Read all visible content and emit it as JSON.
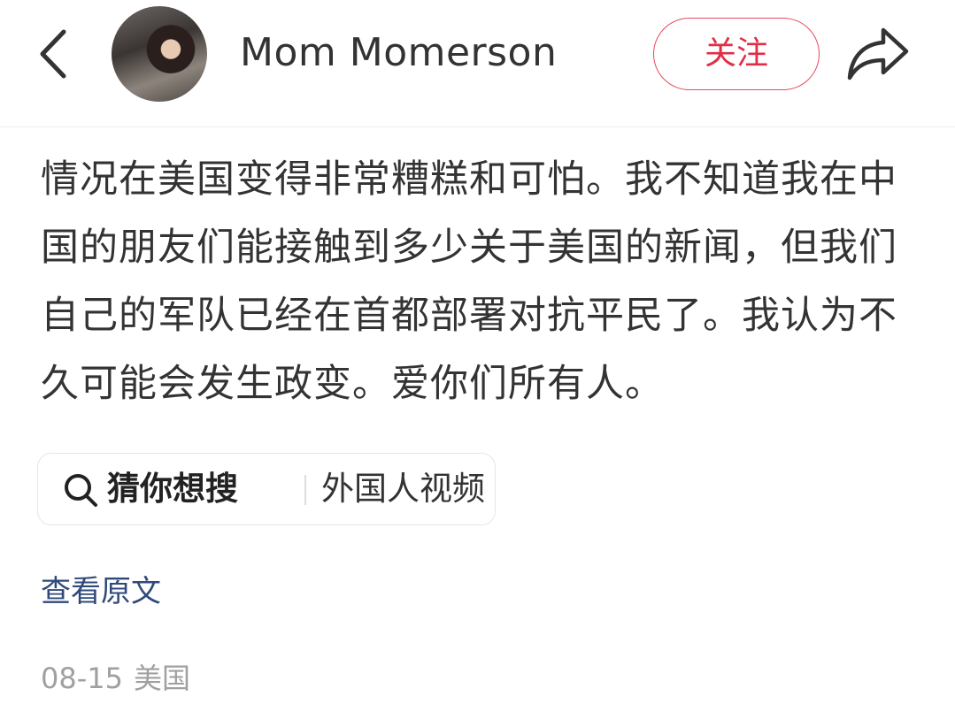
{
  "header": {
    "user_name": "Mom Momerson",
    "follow_label": "关注"
  },
  "icons": {
    "back": "chevron-left-icon",
    "share": "share-arrow-icon",
    "search": "search-icon"
  },
  "colors": {
    "accent": "#e02e45",
    "link": "#2f4a7a",
    "meta": "#a0a0a0",
    "text": "#333333"
  },
  "post": {
    "text": "情况在美国变得非常糟糕和可怕。我不知道我在中国的朋友们能接触到多少关于美国的新闻，但我们自己的军队已经在首都部署对抗平民了。我认为不久可能会发生政变。爱你们所有人。"
  },
  "search_suggestion": {
    "label": "猜你想搜",
    "term": "外国人视频"
  },
  "view_original_label": "查看原文",
  "meta": {
    "date": "08-15",
    "location": "美国"
  }
}
